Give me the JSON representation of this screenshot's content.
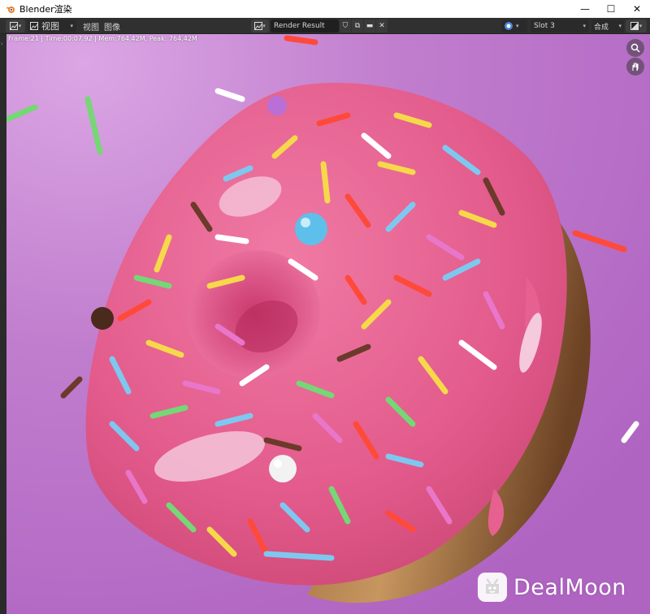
{
  "window": {
    "title": "Blender渲染",
    "minimize": "—",
    "maximize": "☐",
    "close": "✕"
  },
  "header": {
    "view_dropdown": "视图",
    "menus": [
      "视图",
      "图像"
    ],
    "image_name": "Render Result",
    "slot": "Slot 3",
    "layer": "合成"
  },
  "render_info": {
    "text": "Frame:21 | Time:00:07.92 | Mem:764.42M, Peak: 764.42M"
  },
  "colors": {
    "background": "#b86fc7",
    "frosting": "#e8628f",
    "dough": "#7a4f2c",
    "header_bg": "#303030"
  },
  "watermark": {
    "text": "DealMoon"
  }
}
